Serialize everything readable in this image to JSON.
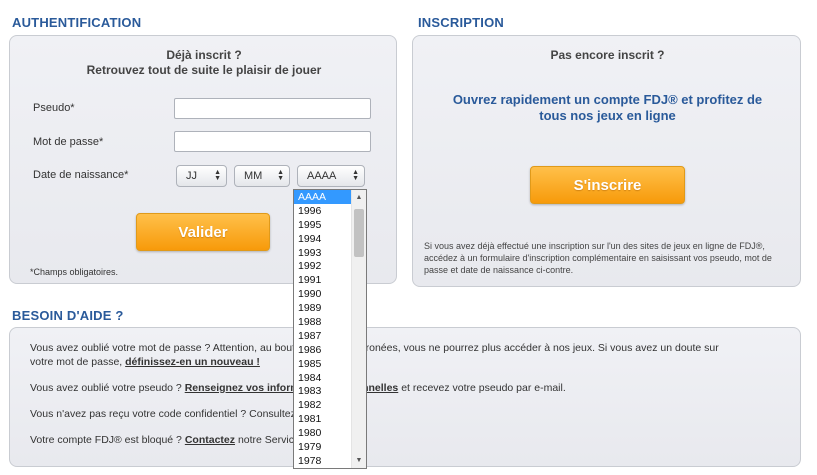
{
  "auth": {
    "title": "AUTHENTIFICATION",
    "intro_line1": "Déjà inscrit ?",
    "intro_line2": "Retrouvez tout de suite le plaisir de jouer",
    "pseudo_label": "Pseudo*",
    "pseudo_value": "",
    "password_label": "Mot de passe*",
    "password_value": "",
    "birthdate_label": "Date de naissance*",
    "day_select": "JJ",
    "month_select": "MM",
    "year_select": "AAAA",
    "submit_label": "Valider",
    "required_note": "*Champs obligatoires."
  },
  "inscription": {
    "title": "INSCRIPTION",
    "question": "Pas encore inscrit ?",
    "pitch_line1": "Ouvrez rapidement un compte FDJ® et profitez de",
    "pitch_line2": "tous nos jeux en ligne",
    "signup_label": "S'inscrire",
    "note_line1": "Si vous avez déjà effectué une inscription sur l'un des sites de jeux en ligne de FDJ®,",
    "note_line2": "accédez à un formulaire d'inscription complémentaire en saisissant vos pseudo, mot de",
    "note_line3": "passe et date de naissance ci-contre."
  },
  "help": {
    "title": "BESOIN D'AIDE ?",
    "line1_text": "Vous avez oublié votre mot de passe ? Attention, au bout de 3 saisies erronées, vous ne pourrez plus accéder à nos jeux. Si vous avez un doute sur",
    "line1b_text": "votre mot de passe,",
    "line1b_link": "définissez-en un nouveau !",
    "line2_text": "Vous avez oublié votre pseudo ?",
    "line2_link": "Renseignez vos informations personnelles",
    "line2_tail": "et recevez votre pseudo par e-mail.",
    "line3_text": "Vous n'avez pas reçu votre code confidentiel ? Consultez la rubrique",
    "line4_text": "Votre compte FDJ® est bloqué ?",
    "line4_link": "Contactez",
    "line4_tail": "notre Service Clients"
  },
  "year_dropdown": {
    "options": [
      "AAAA",
      "1996",
      "1995",
      "1994",
      "1993",
      "1992",
      "1991",
      "1990",
      "1989",
      "1988",
      "1987",
      "1986",
      "1985",
      "1984",
      "1983",
      "1982",
      "1981",
      "1980",
      "1979",
      "1978"
    ],
    "selected": "AAAA"
  },
  "colors": {
    "title_blue": "#2a5a9a",
    "button_orange": "#f79a0a",
    "selection_blue": "#3399ff"
  }
}
